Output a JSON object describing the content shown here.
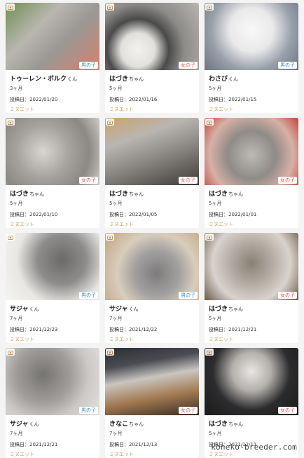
{
  "cards": [
    {
      "name": "トゥーレン・ボルク",
      "honorific": "くん",
      "age": "3ヶ月",
      "date": "投稿日：2022/01/20",
      "breed": "ミヌエット",
      "gender": "男の子",
      "g": "male",
      "photo": "linear-gradient(135deg,#6f8f52 0%,#b9b6b0 35%,#9a9894 60%,#d48270 100%)"
    },
    {
      "name": "はづき",
      "honorific": "ちゃん",
      "age": "5ヶ月",
      "date": "投稿日：2022/01/16",
      "breed": "ミヌエット",
      "gender": "女の子",
      "g": "female",
      "photo": "radial-gradient(circle at 35% 70%,#f4f2ee 0%,#e2e0dc 22%,#4a4a4a 40%,#8d8b88 60%,#b9b6b2 100%)"
    },
    {
      "name": "わさび",
      "honorific": "くん",
      "age": "5ヶ月",
      "date": "投稿日：2022/01/15",
      "breed": "ミヌエット",
      "gender": "男の子",
      "g": "male",
      "photo": "radial-gradient(circle at 50% 40%,#f8f8f8 0%,#e9e9ea 35%,#9aa0aa 65%,#6d7280 100%)"
    },
    {
      "name": "はづき",
      "honorific": "ちゃん",
      "age": "5ヶ月",
      "date": "投稿日：2022/01/10",
      "breed": "ミヌエット",
      "gender": "女の子",
      "g": "female",
      "photo": "radial-gradient(circle at 40% 50%,#d9d6d2 0%,#a6a29d 40%,#8c8985 70%,#cfcac5 100%)"
    },
    {
      "name": "はづき",
      "honorific": "ちゃん",
      "age": "5ヶ月",
      "date": "投稿日：2022/01/05",
      "breed": "ミヌエット",
      "gender": "女の子",
      "g": "female",
      "photo": "linear-gradient(160deg,#caa36d 0%,#b9b5b0 30%,#8f8c88 55%,#3e3b37 100%)"
    },
    {
      "name": "はづき",
      "honorific": "ちゃん",
      "age": "5ヶ月",
      "date": "投稿日：2022/01/01",
      "breed": "ミヌエット",
      "gender": "女の子",
      "g": "female",
      "photo": "radial-gradient(circle at 50% 55%,#bdb9b5 0%,#8f8b87 40%,#d7b0a6 70%,#c0453a 100%)"
    },
    {
      "name": "サジャ",
      "honorific": "くん",
      "age": "7ヶ月",
      "date": "投稿日：2021/12/23",
      "breed": "ミヌエット",
      "gender": "男の子",
      "g": "male",
      "photo": "radial-gradient(circle at 60% 40%,#6b6a69 0%,#8e8c8a 35%,#e9e7e4 65%,#f5f4f2 100%)"
    },
    {
      "name": "サジャ",
      "honorific": "くん",
      "age": "7ヶ月",
      "date": "投稿日：2021/12/22",
      "breed": "ミヌエット",
      "gender": "男の子",
      "g": "male",
      "photo": "radial-gradient(circle at 55% 60%,#7d7c7c 0%,#a3a1a0 35%,#d8cdbd 60%,#c0a27d 100%)"
    },
    {
      "name": "はづき",
      "honorific": "ちゃん",
      "age": "5ヶ月",
      "date": "投稿日：2021/12/21",
      "breed": "ミヌエット",
      "gender": "女の子",
      "g": "female",
      "photo": "radial-gradient(circle at 50% 45%,#8a7f74 0%,#b9b2aa 40%,#d8d3ce 65%,#6b5a48 100%)"
    },
    {
      "name": "サジャ",
      "honorific": "くん",
      "age": "7ヶ月",
      "date": "投稿日：2021/12/21",
      "breed": "ミヌエット",
      "gender": "男の子",
      "g": "male",
      "photo": "radial-gradient(circle at 40% 40%,#767472 0%,#a09d9a 40%,#cbc8c5 65%,#e4e2df 100%)"
    },
    {
      "name": "きなこ",
      "honorific": "ちゃん",
      "age": "7ヶ月",
      "date": "投稿日：2021/12/13",
      "breed": "ミヌエット",
      "gender": "女の子",
      "g": "female",
      "photo": "linear-gradient(170deg,#2a2d33 0%,#4a4c52 25%,#c9c5c1 45%,#a27a52 70%,#3a2c22 100%)"
    },
    {
      "name": "はづき",
      "honorific": "ちゃん",
      "age": "5ヶ月",
      "date": "投稿日：2021/12/11",
      "breed": "ミヌエット",
      "gender": "女の子",
      "g": "female",
      "photo": "radial-gradient(circle at 50% 35%,#e8e6e3 0%,#b4b0ac 30%,#2c2c2e 60%,#1a1a1b 100%)"
    }
  ],
  "watermark": "koneko-breeder.com",
  "icons": {
    "camera": "camera-icon"
  }
}
